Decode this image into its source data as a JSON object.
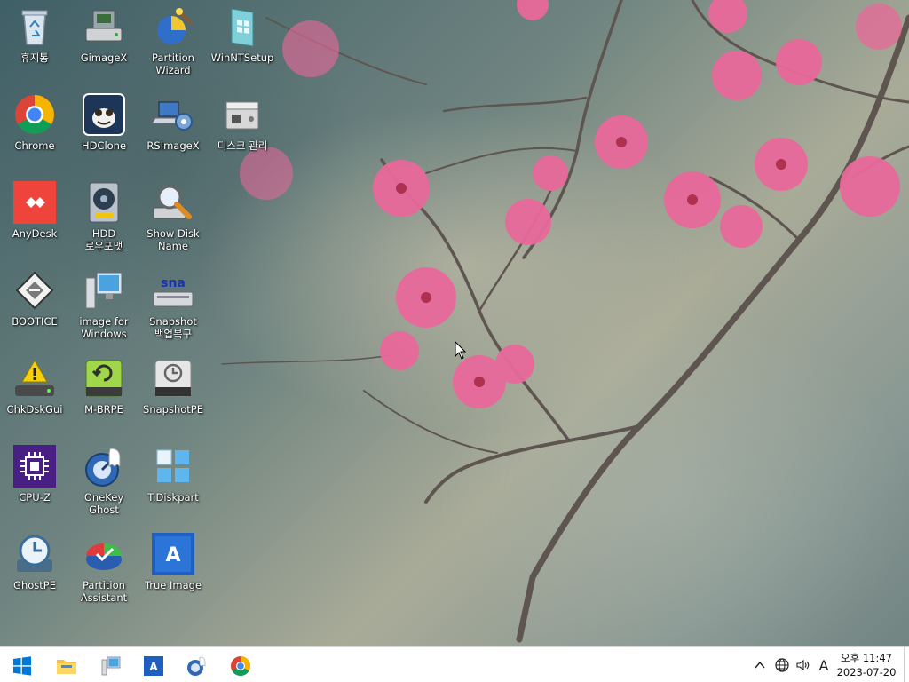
{
  "desktop": {
    "icons": [
      {
        "id": "recycle-bin",
        "label": "휴지통"
      },
      {
        "id": "gimagex",
        "label": "GimageX"
      },
      {
        "id": "partition-wizard",
        "label": "Partition\nWizard"
      },
      {
        "id": "winntsetup",
        "label": "WinNTSetup"
      },
      {
        "id": "chrome",
        "label": "Chrome"
      },
      {
        "id": "hdclone",
        "label": "HDClone"
      },
      {
        "id": "rsimagex",
        "label": "RSImageX"
      },
      {
        "id": "disk-management",
        "label": "디스크 관리"
      },
      {
        "id": "anydesk",
        "label": "AnyDesk"
      },
      {
        "id": "hdd-low-format",
        "label": "HDD\n로우포맷"
      },
      {
        "id": "show-disk-name",
        "label": "Show Disk\nName"
      },
      {
        "id": "bootice",
        "label": "BOOTICE"
      },
      {
        "id": "image-for-windows",
        "label": "image for\nWindows"
      },
      {
        "id": "snapshot-backup",
        "label": "Snapshot\n백업복구"
      },
      {
        "id": "chkdskgui",
        "label": "ChkDskGui"
      },
      {
        "id": "m-brpe",
        "label": "M-BRPE"
      },
      {
        "id": "snapshotpe",
        "label": "SnapshotPE"
      },
      {
        "id": "cpu-z",
        "label": "CPU-Z"
      },
      {
        "id": "onekey-ghost",
        "label": "OneKey\nGhost"
      },
      {
        "id": "t-diskpart",
        "label": "T.Diskpart"
      },
      {
        "id": "ghostpe",
        "label": "GhostPE"
      },
      {
        "id": "partition-assistant",
        "label": "Partition\nAssistant"
      },
      {
        "id": "true-image",
        "label": "True Image"
      }
    ],
    "snapshot_icon_text": "sna",
    "true_image_icon_text": "A"
  },
  "taskbar": {
    "pinned": [
      "start",
      "file-explorer",
      "image-for-windows",
      "true-image",
      "onekey-ghost",
      "chrome"
    ],
    "tray": {
      "ime_indicator": "A",
      "time": "오후 11:47",
      "date": "2023-07-20"
    }
  },
  "colors": {
    "start_blue": "#0078d7",
    "anydesk_red": "#ef443b",
    "cpuz_purple": "#4a1f84",
    "true_image_blue": "#1f5fbf"
  }
}
